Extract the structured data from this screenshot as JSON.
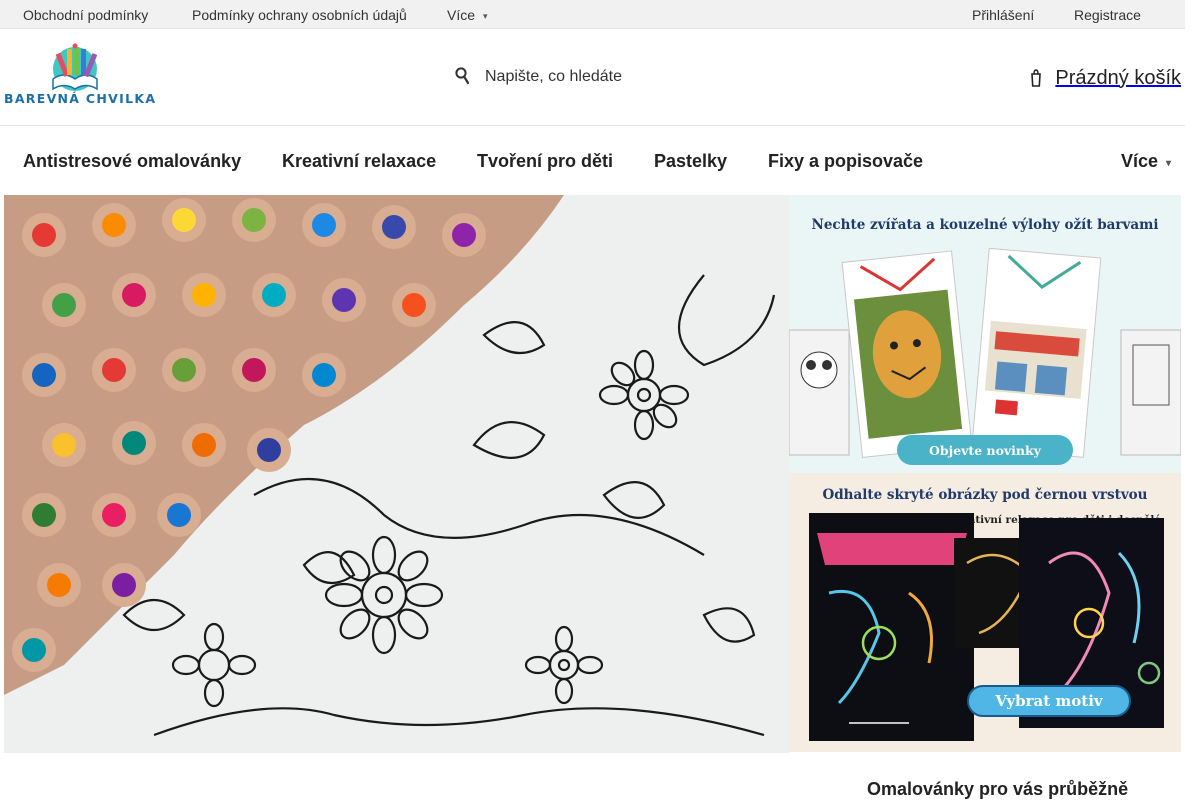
{
  "topbar": {
    "links": [
      "Obchodní podmínky",
      "Podmínky ochrany osobních údajů"
    ],
    "more_label": "Více",
    "login_label": "Přihlášení",
    "register_label": "Registrace"
  },
  "header": {
    "logo_text": "BAREVNÁ CHVILKA",
    "search_placeholder": "Napište, co hledáte",
    "search_icon": "search-icon",
    "cart_label": "Prázdný košík",
    "cart_icon": "cart-icon"
  },
  "nav": {
    "items": [
      "Antistresové omalovánky",
      "Kreativní relaxace",
      "Tvoření pro děti",
      "Pastelky",
      "Fixy a popisovače"
    ],
    "more_label": "Více"
  },
  "banner1": {
    "title": "Nechte zvířata a kouzelné výlohy ožít barvami",
    "button_label": "Objevte novinky"
  },
  "banner2": {
    "title": "Odhalte skryté obrázky pod černou vrstvou",
    "subtitle": "Kreativní relaxace pro děti i dospělé",
    "button_label": "Vybrat motiv"
  },
  "section_heading": "Omalovánky pro vás průběžně",
  "colors": {
    "brand": "#1c6fa8",
    "topbar_bg": "#f1f1f1",
    "banner_button_blue": "#4fb6e6",
    "banner_button_teal": "#4ab3c7"
  }
}
